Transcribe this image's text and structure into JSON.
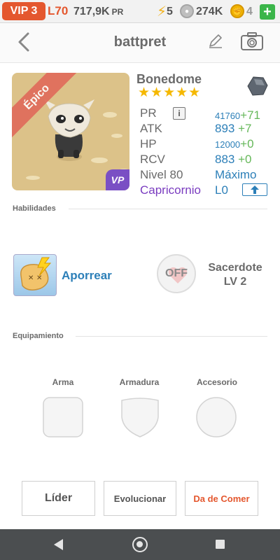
{
  "status_bar": {
    "vip": "VIP 3",
    "level": "L70",
    "pr_total": "717,9K",
    "pr_unit": "PR",
    "energy": "5",
    "coins": "274K",
    "gems": "4",
    "add": "+"
  },
  "header": {
    "title": "battpret",
    "icons": [
      "back-icon",
      "edit-icon",
      "camera-icon"
    ]
  },
  "pet": {
    "rarity": "Épico",
    "badge": "VP",
    "name": "Bonedome",
    "stars": "★★★★★",
    "element_icon": "rock-element-icon",
    "stats": {
      "pr": {
        "label": "PR",
        "value": "41760",
        "bonus": "+71"
      },
      "atk": {
        "label": "ATK",
        "value": "893",
        "bonus": "+7"
      },
      "hp": {
        "label": "HP",
        "value": "12000",
        "bonus": "+0"
      },
      "rcv": {
        "label": "RCV",
        "value": "883",
        "bonus": "+0"
      },
      "level": {
        "label": "Nivel 80",
        "value": "Máximo"
      },
      "zodiac": {
        "label": "Capricornio",
        "value": "L0"
      }
    }
  },
  "skills": {
    "section_title": "Habilidades",
    "active_name": "Aporrear",
    "off_label": "OFF",
    "leader_line1": "Sacerdote",
    "leader_line2": "LV 2"
  },
  "equipment": {
    "section_title": "Equipamiento",
    "weapon": "Arma",
    "armor": "Armadura",
    "accessory": "Accesorio"
  },
  "actions": {
    "leader": "Líder",
    "evolve": "Evolucionar",
    "feed": "Da de Comer"
  },
  "colors": {
    "accent_orange": "#e4572e",
    "value_blue": "#2c7fb8",
    "bonus_green": "#66b85a",
    "zodiac_purple": "#7a3cc0",
    "star_gold": "#f5b800"
  }
}
